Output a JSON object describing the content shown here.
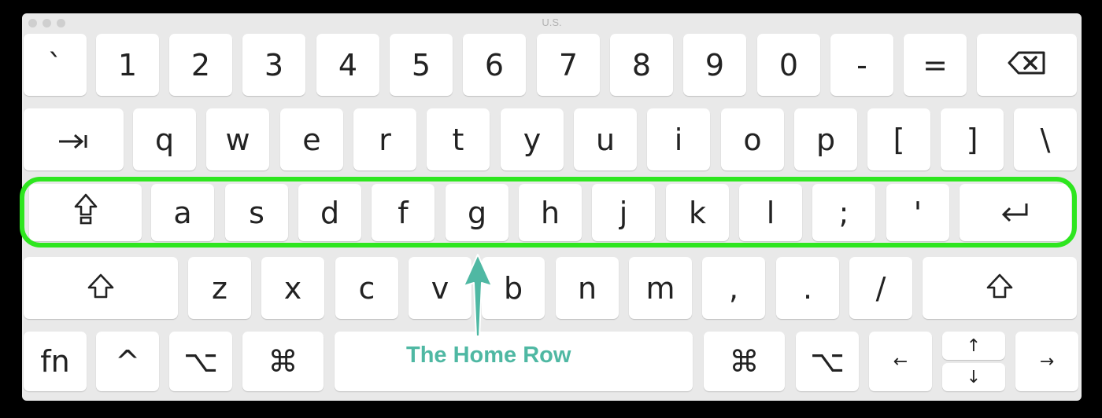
{
  "window": {
    "title": "U.S."
  },
  "colors": {
    "highlight": "#2ee61f",
    "annotation": "#4fb8a3"
  },
  "annotation": {
    "label": "The Home Row"
  },
  "keys": {
    "row1": [
      "`",
      "1",
      "2",
      "3",
      "4",
      "5",
      "6",
      "7",
      "8",
      "9",
      "0",
      "-",
      "=",
      "⌫"
    ],
    "row2": [
      "⇥",
      "q",
      "w",
      "e",
      "r",
      "t",
      "y",
      "u",
      "i",
      "o",
      "p",
      "[",
      "]",
      "\\"
    ],
    "row3": [
      "⇪",
      "a",
      "s",
      "d",
      "f",
      "g",
      "h",
      "j",
      "k",
      "l",
      ";",
      "'",
      "↩"
    ],
    "row4": [
      "⇧",
      "z",
      "x",
      "c",
      "v",
      "b",
      "n",
      "m",
      ",",
      ".",
      "/",
      "⇧"
    ],
    "row5": [
      "fn",
      "^",
      "⌥",
      "⌘",
      "",
      "⌘",
      "⌥",
      "←",
      "↑",
      "↓",
      "→"
    ]
  }
}
